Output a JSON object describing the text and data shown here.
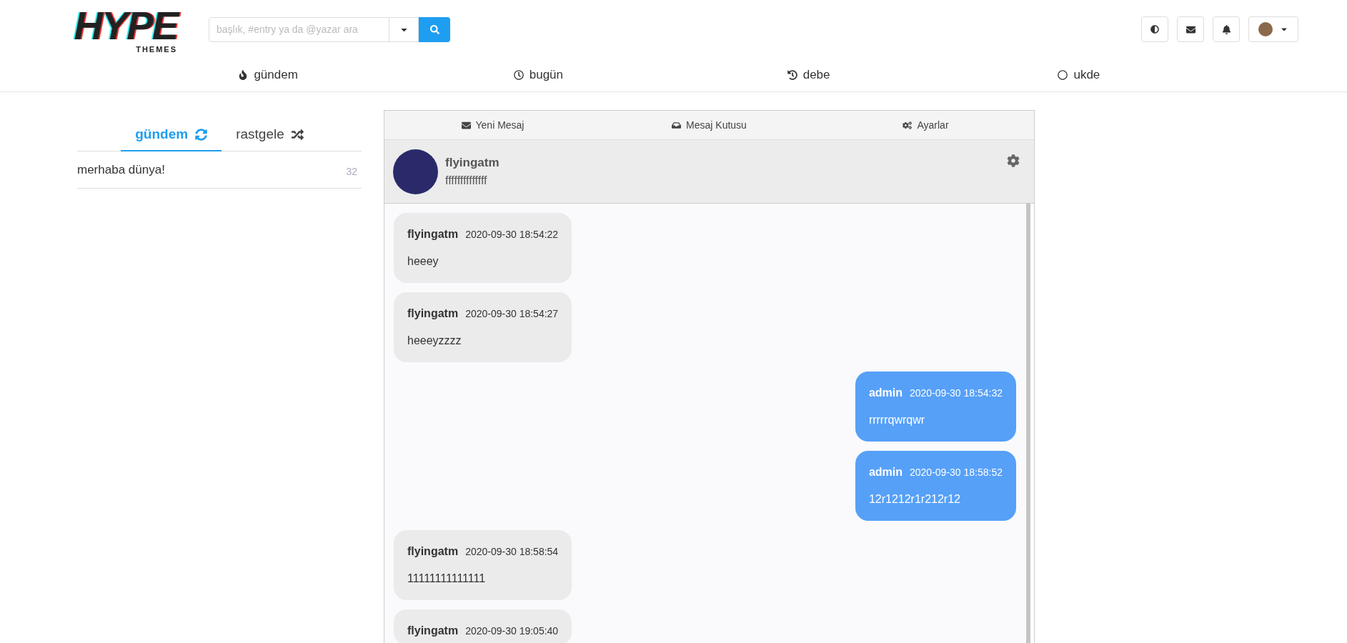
{
  "logo": {
    "title": "HYPE",
    "subtitle": "THEMES"
  },
  "search": {
    "placeholder": "başlık, #entry ya da @yazar ara"
  },
  "nav": [
    {
      "label": "gündem"
    },
    {
      "label": "bugün"
    },
    {
      "label": "debe"
    },
    {
      "label": "ukde"
    }
  ],
  "side_tabs": [
    {
      "label": "gündem",
      "selected": true
    },
    {
      "label": "rastgele",
      "selected": false
    }
  ],
  "topics": [
    {
      "title": "merhaba dünya!",
      "count": "32"
    }
  ],
  "message_tabs": [
    {
      "label": "Yeni Mesaj"
    },
    {
      "label": "Mesaj Kutusu"
    },
    {
      "label": "Ayarlar"
    }
  ],
  "conversation": {
    "name": "flyingatm",
    "status": "ffffffffffffff"
  },
  "messages": [
    {
      "kind": "incoming",
      "author": "flyingatm",
      "time": "2020-09-30 18:54:22",
      "text": "heeey"
    },
    {
      "kind": "incoming",
      "author": "flyingatm",
      "time": "2020-09-30 18:54:27",
      "text": "heeeyzzzz"
    },
    {
      "kind": "outgoing",
      "author": "admin",
      "time": "2020-09-30 18:54:32",
      "text": "rrrrrqwrqwr"
    },
    {
      "kind": "outgoing",
      "author": "admin",
      "time": "2020-09-30 18:58:52",
      "text": "12r1212r1r212r12"
    },
    {
      "kind": "incoming",
      "author": "flyingatm",
      "time": "2020-09-30 18:58:54",
      "text": "11111111111111"
    },
    {
      "kind": "incoming",
      "author": "flyingatm",
      "time": "2020-09-30 19:05:40"
    }
  ]
}
